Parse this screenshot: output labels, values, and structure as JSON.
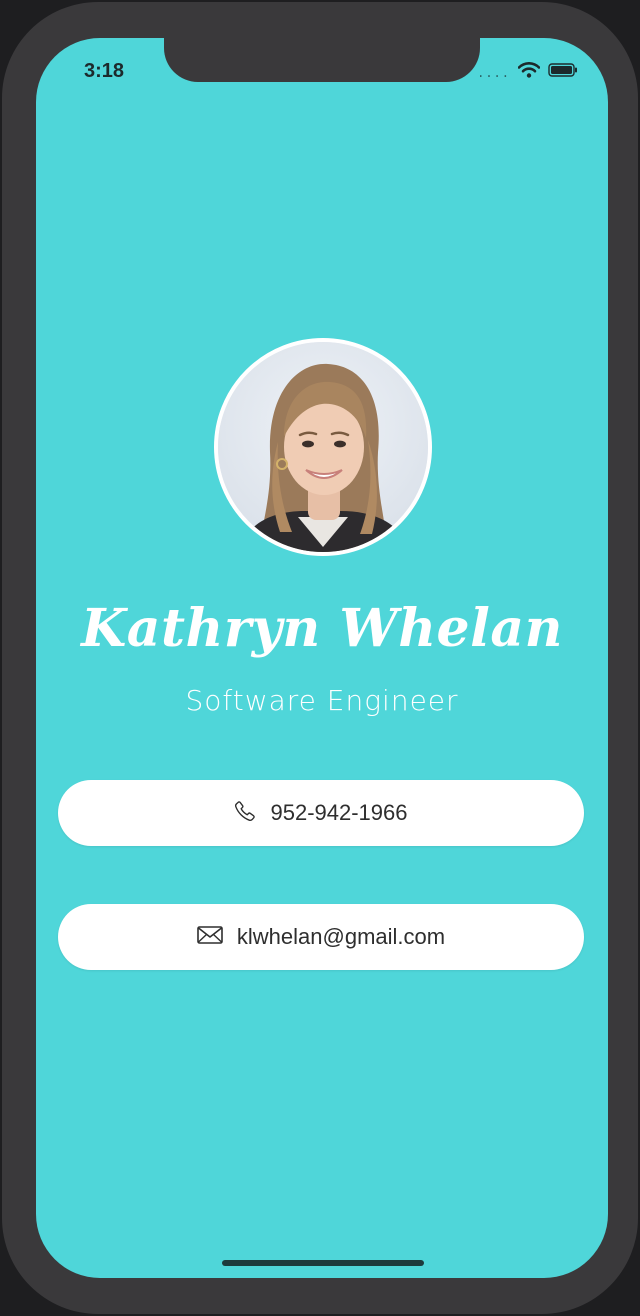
{
  "status_bar": {
    "time": "3:18",
    "signal": "....",
    "icons": [
      "wifi-icon",
      "battery-icon"
    ]
  },
  "profile": {
    "name": "Kathryn Whelan",
    "title": "Software Engineer",
    "avatar": "profile-photo"
  },
  "contacts": {
    "phone": {
      "icon": "phone-icon",
      "text": "952-942-1966"
    },
    "email": {
      "icon": "mail-icon",
      "text": "klwhelan@gmail.com"
    }
  },
  "colors": {
    "background": "#4fd6d9",
    "bezel": "#3a393b",
    "card": "#ffffff",
    "text": "#2e2e2e"
  }
}
